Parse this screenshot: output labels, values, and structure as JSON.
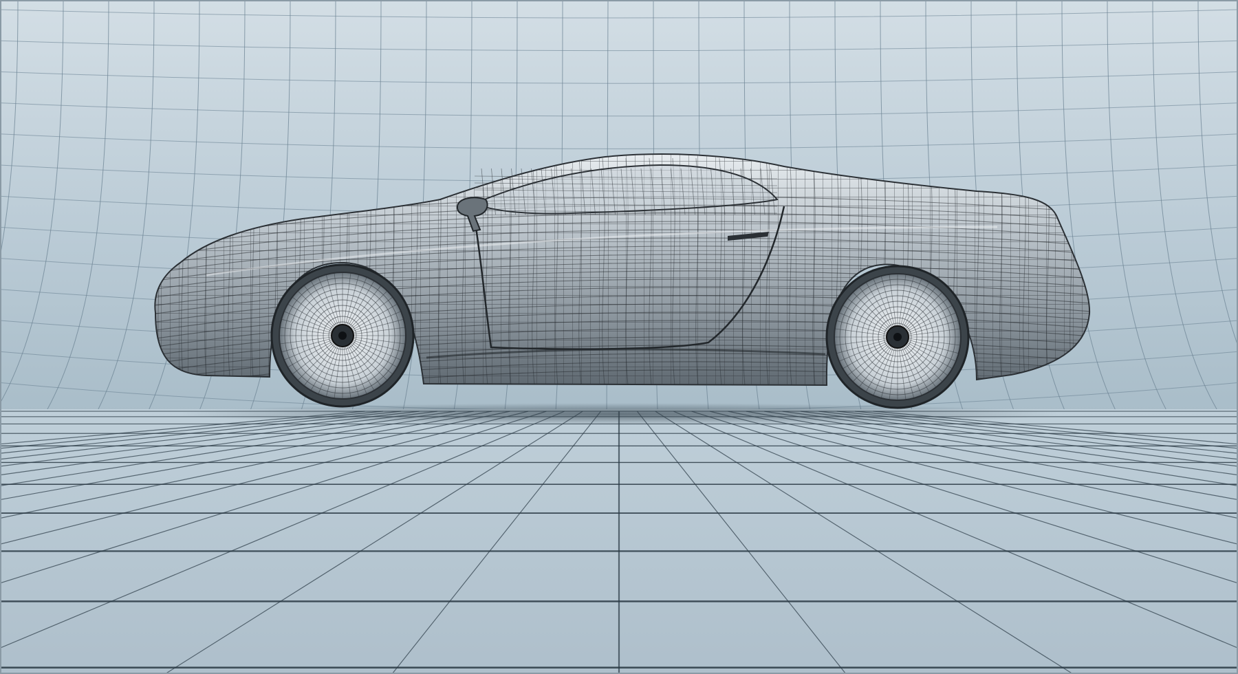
{
  "scene": {
    "subject": "car-wireframe",
    "palette": {
      "backdrop": "#c2d2dc",
      "floor": "#b4c7d2",
      "grid_line": "#6d8494",
      "floor_line": "#2a3944",
      "car_body": "#8f9aa3",
      "car_body_light": "#d8dee3",
      "mesh_line": "#2e3338",
      "wheel": "#cfd6db",
      "shadow": "#3a4650"
    }
  }
}
